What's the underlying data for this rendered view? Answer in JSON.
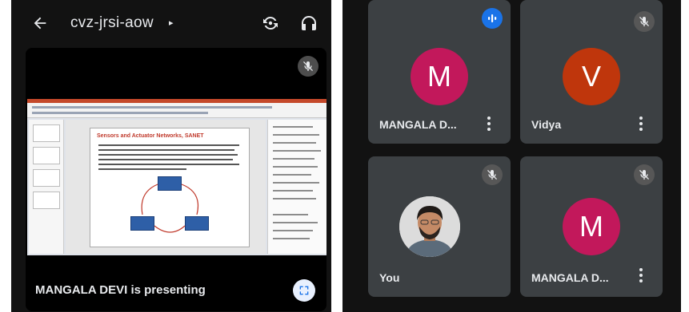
{
  "meeting": {
    "code": "cvz-jrsi-aow",
    "caret": "▸"
  },
  "presentation": {
    "label": "MANGALA DEVI is presenting",
    "slide_title": "Sensors and Actuator Networks, SANET"
  },
  "participants": [
    {
      "name": "MANGALA D...",
      "initial": "M",
      "avatar_color": "#c2185b",
      "status": "speaking"
    },
    {
      "name": "Vidya",
      "initial": "V",
      "avatar_color": "#bf360c",
      "status": "muted"
    },
    {
      "name": "You",
      "initial": "",
      "avatar_color": "#e6e6e6",
      "status": "muted"
    },
    {
      "name": "MANGALA D...",
      "initial": "M",
      "avatar_color": "#c2185b",
      "status": "muted"
    }
  ],
  "colors": {
    "background": "#121212",
    "tile": "#3c4043",
    "speaking_accent": "#1a73e8",
    "text": "#e8eaed"
  },
  "icons": {
    "back": "arrow-left-icon",
    "switch_camera": "switch-camera-icon",
    "audio": "headphones-icon",
    "mute": "mic-off-icon",
    "speaking": "audio-level-icon",
    "fullscreen": "fullscreen-icon",
    "menu": "more-vert-icon"
  }
}
